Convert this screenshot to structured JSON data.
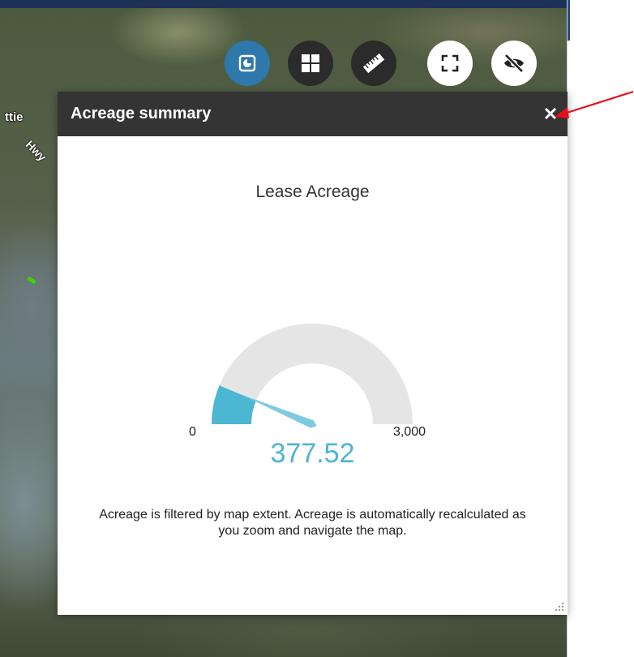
{
  "map": {
    "road_labels": [
      "ttie",
      "Hwy"
    ]
  },
  "toolbar": {
    "buttons": [
      {
        "name": "chart-icon",
        "state": "active"
      },
      {
        "name": "grid-icon",
        "state": "dark"
      },
      {
        "name": "ruler-icon",
        "state": "dark"
      },
      {
        "name": "fullscreen-icon",
        "state": "light"
      },
      {
        "name": "eye-off-icon",
        "state": "light"
      }
    ]
  },
  "panel": {
    "title": "Acreage summary",
    "close_label": "×",
    "gauge": {
      "title": "Lease Acreage",
      "min_label": "0",
      "max_label": "3,000",
      "min": 0,
      "max": 3000,
      "value": 377.52,
      "value_label": "377.52",
      "fill_color": "#4bb7d3",
      "track_color": "#e5e5e5"
    },
    "note": "Acreage is filtered by map extent. Acreage is automatically recalculated as you zoom and navigate the map."
  },
  "annotation": {
    "arrow_color": "#e8101a"
  }
}
